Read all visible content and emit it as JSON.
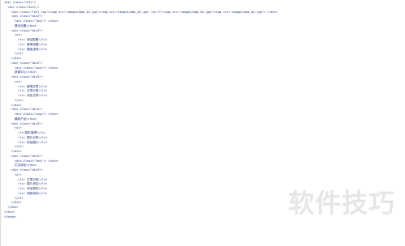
{
  "code_lines": [
    "<div class=\"left\">",
    "  <div class=\"div1\">",
    "    <div class=\"left_top\"><img src=\"images/bbb_01.jpg\"><img src=\"images/bbb_02.jpg\" id=\"2\"><img src=\"images/bbb_03.jpg\"><img src=\"images/bbb_04.jpg\"> </div>",
    "    <div class=\"div2\">",
    "      <div class=\"jbsz\"> </div>",
    "      基本设置</div>",
    "    <div class=\"div3\">",
    "      <ul>",
    "        <li> 网站配置</li>",
    "        <li> 管理设置</li>",
    "        <li> 模板选择</li>",
    "      </ul>",
    "    </div>",
    "    <div class=\"div2\">",
    "      <div class=\"xwzx\"> </div>",
    "      新闻中心</div>",
    "    <div class=\"div3\">",
    "      <ul>",
    "        <li> 管理文章</li>",
    "        <li> 文章分类</li>",
    "        <li> 添加文章</li>",
    "      </ul>",
    "    </div>",
    "    <div class=\"div2\">",
    "      <div class=\"zxcp\"> </div>",
    "      最新产品</div>",
    "    <div class=\"div3\">",
    "      <ul>",
    "        <li>图片管理</li>",
    "        <li> 图片分类</li>",
    "        <li> 添加图片</li>",
    "      </ul>",
    "    </div>",
    "    <div class=\"div2\">",
    "      <div class=\"lmtj\"> </div>",
    "      栏目添加</div>",
    "    <div class=\"div3\">",
    "      <ul>",
    "        <li> 文章分类</li>",
    "        <li> 图片添加</li>",
    "        <li> 添加类别</li>",
    "        <li> 视频添加</li>",
    "      </ul>",
    "    </div>",
    "  </div>",
    "</div>",
    "</body>"
  ],
  "watermark_text": "软件技巧",
  "colors": {
    "code": "#1f2e7a",
    "background": "#ffffff",
    "watermark": "#e6e6e6"
  }
}
